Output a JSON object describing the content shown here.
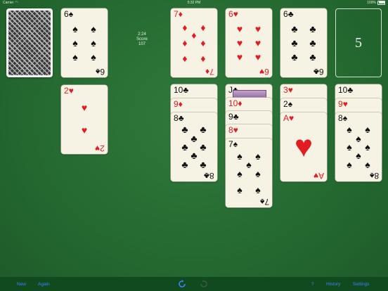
{
  "status_bar": {
    "carrier": "Carrier",
    "time": "5:32 PM",
    "battery": "100%"
  },
  "game": {
    "time": "2:24",
    "score_label": "Score",
    "score_value": "107"
  },
  "deck": {
    "label": "stock",
    "remaining_count": "5"
  },
  "waste": [
    {
      "rank": "6",
      "suit": "♠",
      "color": "black"
    },
    {
      "rank": "2",
      "suit": "♥",
      "color": "red"
    }
  ],
  "foundations": [
    {
      "rank": "7",
      "suit": "♦",
      "color": "red"
    },
    {
      "rank": "6",
      "suit": "♥",
      "color": "red"
    },
    {
      "rank": "6",
      "suit": "♣",
      "color": "black"
    }
  ],
  "tableau": [
    {
      "cards": [
        {
          "rank": "10",
          "suit": "♣",
          "color": "black"
        },
        {
          "rank": "9",
          "suit": "♦",
          "color": "red"
        },
        {
          "rank": "8",
          "suit": "♣",
          "color": "black"
        }
      ]
    },
    {
      "cards": [
        {
          "rank": "J",
          "suit": "♣",
          "color": "black"
        },
        {
          "rank": "10",
          "suit": "♦",
          "color": "red"
        },
        {
          "rank": "9",
          "suit": "♣",
          "color": "black"
        },
        {
          "rank": "8",
          "suit": "♥",
          "color": "red"
        },
        {
          "rank": "7",
          "suit": "♠",
          "color": "black"
        }
      ]
    },
    {
      "cards": [
        {
          "rank": "3",
          "suit": "♥",
          "color": "red"
        },
        {
          "rank": "2",
          "suit": "♠",
          "color": "black"
        },
        {
          "rank": "A",
          "suit": "♥",
          "color": "red"
        }
      ]
    },
    {
      "cards": [
        {
          "rank": "10",
          "suit": "♣",
          "color": "black"
        },
        {
          "rank": "9",
          "suit": "♥",
          "color": "red"
        },
        {
          "rank": "8",
          "suit": "♠",
          "color": "black"
        }
      ]
    }
  ],
  "toolbar": {
    "new_label": "New",
    "again_label": "Again",
    "undo_icon": "undo-icon",
    "redo_icon": "redo-icon",
    "help_label": "?",
    "history_label": "History",
    "settings_label": "Settings"
  },
  "colors": {
    "felt": "#256a31",
    "card_face": "#f7f3e4",
    "red_suit": "#e31b23",
    "toolbar_blue": "#3d82ff"
  }
}
